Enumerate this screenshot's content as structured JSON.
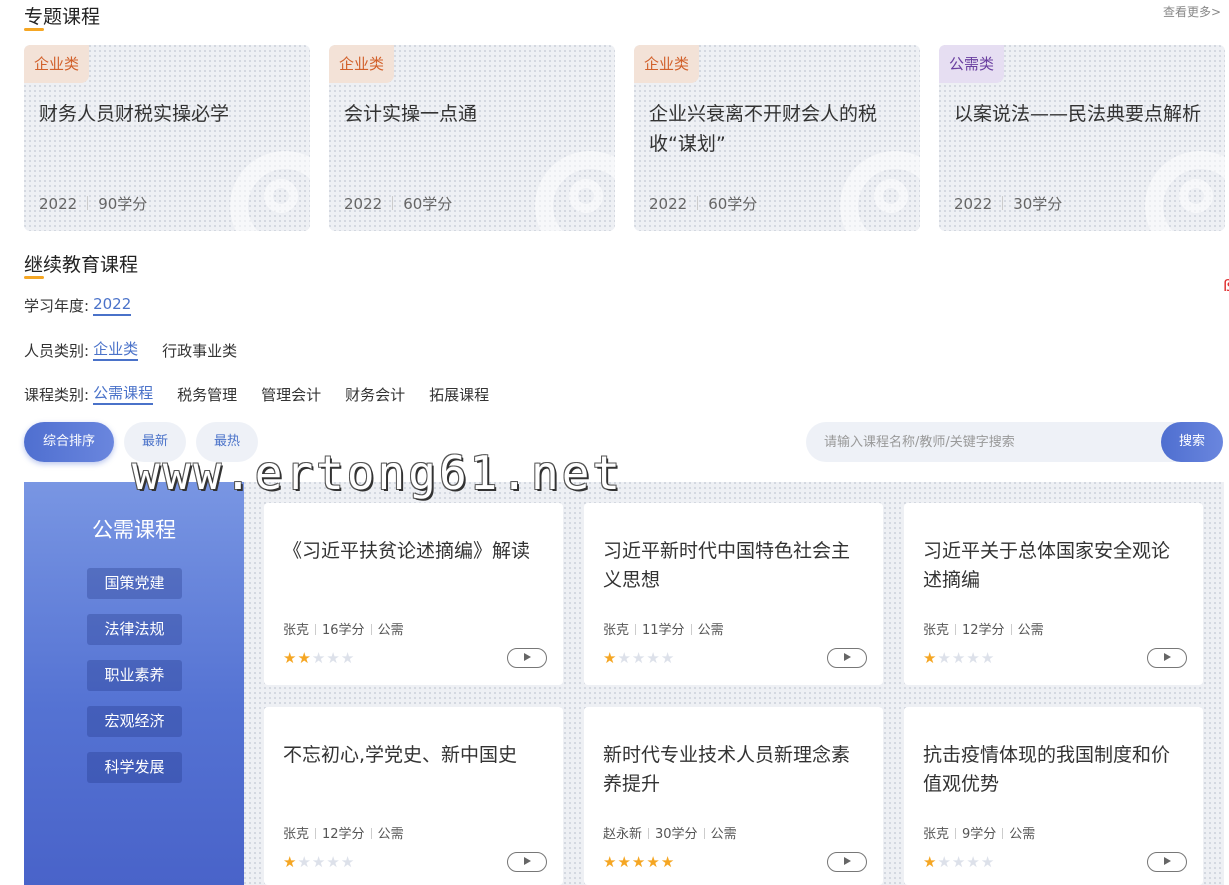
{
  "topics": {
    "title": "专题课程",
    "see_more": "查看更多>",
    "cards": [
      {
        "tag": "企业类",
        "title": "财务人员财税实操必学",
        "year": "2022",
        "credits": "90学分"
      },
      {
        "tag": "企业类",
        "title": "会计实操一点通",
        "year": "2022",
        "credits": "60学分"
      },
      {
        "tag": "企业类",
        "title": "企业兴衰离不开财会人的税收“谋划”",
        "year": "2022",
        "credits": "60学分"
      },
      {
        "tag": "公需类",
        "title": "以案说法——民法典要点解析",
        "year": "2022",
        "credits": "30学分"
      }
    ]
  },
  "continuing": {
    "title": "继续教育课程",
    "year_label": "学习年度:",
    "year_options": [
      "2022"
    ],
    "people_label": "人员类别:",
    "people_options": [
      "企业类",
      "行政事业类"
    ],
    "category_label": "课程类别:",
    "category_options": [
      "公需课程",
      "税务管理",
      "管理会计",
      "财务会计",
      "拓展课程"
    ]
  },
  "sort": {
    "comprehensive": "综合排序",
    "newest": "最新",
    "hottest": "最热"
  },
  "search": {
    "placeholder": "请输入课程名称/教师/关键字搜索",
    "button": "搜索"
  },
  "watermark": "www.ertong61.net",
  "side": {
    "title": "公需课程",
    "items": [
      "国策党建",
      "法律法规",
      "职业素养",
      "宏观经济",
      "科学发展"
    ]
  },
  "courses": [
    {
      "title": "《习近平扶贫论述摘编》解读",
      "teacher": "张克",
      "credits": "16学分",
      "type": "公需",
      "rating": 2
    },
    {
      "title": "习近平新时代中国特色社会主义思想",
      "teacher": "张克",
      "credits": "11学分",
      "type": "公需",
      "rating": 1
    },
    {
      "title": "习近平关于总体国家安全观论述摘编",
      "teacher": "张克",
      "credits": "12学分",
      "type": "公需",
      "rating": 1
    },
    {
      "title": "不忘初心,学党史、新中国史",
      "teacher": "张克",
      "credits": "12学分",
      "type": "公需",
      "rating": 1
    },
    {
      "title": "新时代专业技术人员新理念素养提升",
      "teacher": "赵永新",
      "credits": "30学分",
      "type": "公需",
      "rating": 5
    },
    {
      "title": "抗击疫情体现的我国制度和价值观优势",
      "teacher": "张克",
      "credits": "9学分",
      "type": "公需",
      "rating": 1
    }
  ],
  "colors": {
    "accent": "#4a72c9",
    "underline": "#f5a623",
    "star": "#f5a623"
  }
}
